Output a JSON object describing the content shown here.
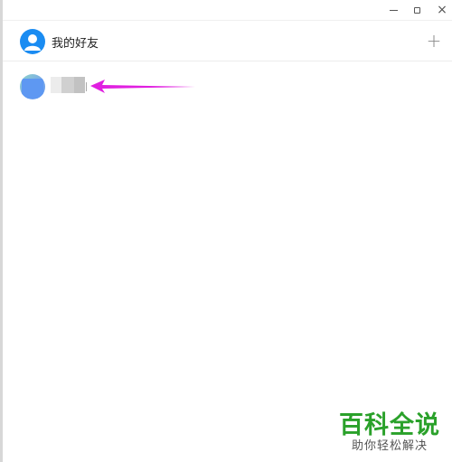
{
  "window_controls": {
    "minimize_icon": "minimize-icon",
    "maximize_icon": "maximize-icon",
    "close_icon": "close-icon",
    "close_glyph": "×"
  },
  "header": {
    "title": "我的好友",
    "avatar_icon": "user-avatar-icon",
    "avatar_color": "#1a8cf2",
    "add_icon": "plus-icon",
    "add_glyph": "+"
  },
  "friends": [
    {
      "avatar": "friend-avatar",
      "name_blurred": true
    }
  ],
  "annotation": {
    "arrow_color": "#e01fe0"
  },
  "watermark": {
    "brand": "百科全说",
    "tagline": "助你轻松解决",
    "brand_color": "#2aa12a"
  }
}
